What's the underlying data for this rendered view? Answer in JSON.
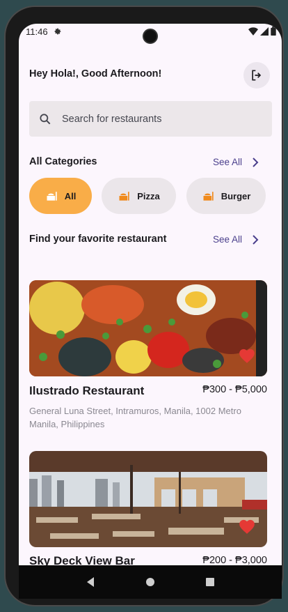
{
  "status": {
    "time": "11:46"
  },
  "header": {
    "greeting": "Hey Hola!, Good Afternoon!"
  },
  "search": {
    "placeholder": "Search for restaurants"
  },
  "categories": {
    "title": "All Categories",
    "see_all": "See All",
    "items": [
      {
        "label": "All",
        "selected": true
      },
      {
        "label": "Pizza",
        "selected": false
      },
      {
        "label": "Burger",
        "selected": false
      }
    ]
  },
  "restaurants": {
    "title": "Find your favorite restaurant",
    "see_all": "See All",
    "items": [
      {
        "name": "Ilustrado Restaurant",
        "price": "₱300 - ₱5,000",
        "address": "General Luna Street, Intramuros, Manila, 1002 Metro Manila, Philippines",
        "favorite": true
      },
      {
        "name": "Sky Deck View Bar",
        "price": "₱200 - ₱3,000",
        "favorite": true
      }
    ]
  },
  "colors": {
    "accent": "#f9ad48",
    "chip_bg": "#ebe6ea",
    "see_all": "#4a3f8c",
    "heart": "#e53935",
    "icon_orange": "#f08a1c"
  }
}
